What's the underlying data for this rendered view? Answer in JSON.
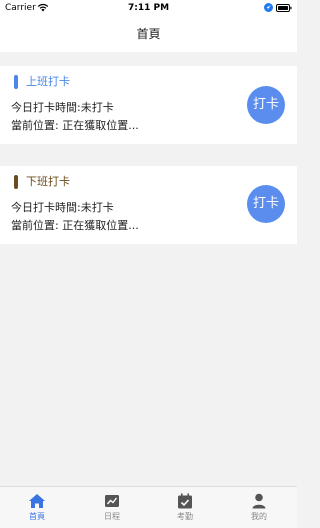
{
  "status_bar": {
    "carrier": "Carrier",
    "time": "7:11 PM"
  },
  "nav": {
    "title": "首頁"
  },
  "cards": [
    {
      "title": "上班打卡",
      "today_time": "今日打卡時間:未打卡",
      "location": "當前位置: 正在獲取位置...",
      "button": "打卡",
      "accent": "#4a86e8"
    },
    {
      "title": "下班打卡",
      "today_time": "今日打卡時間:未打卡",
      "location": "當前位置: 正在獲取位置...",
      "button": "打卡",
      "accent": "#6b4c1e"
    }
  ],
  "tabs": [
    {
      "label": "首頁",
      "icon": "home-icon",
      "active": true
    },
    {
      "label": "日程",
      "icon": "chart-icon",
      "active": false
    },
    {
      "label": "考勤",
      "icon": "calendar-check-icon",
      "active": false
    },
    {
      "label": "我的",
      "icon": "user-icon",
      "active": false
    }
  ],
  "colors": {
    "active_tab": "#3a73e4",
    "inactive_tab": "#888888",
    "punch_button": "#5b8def"
  }
}
